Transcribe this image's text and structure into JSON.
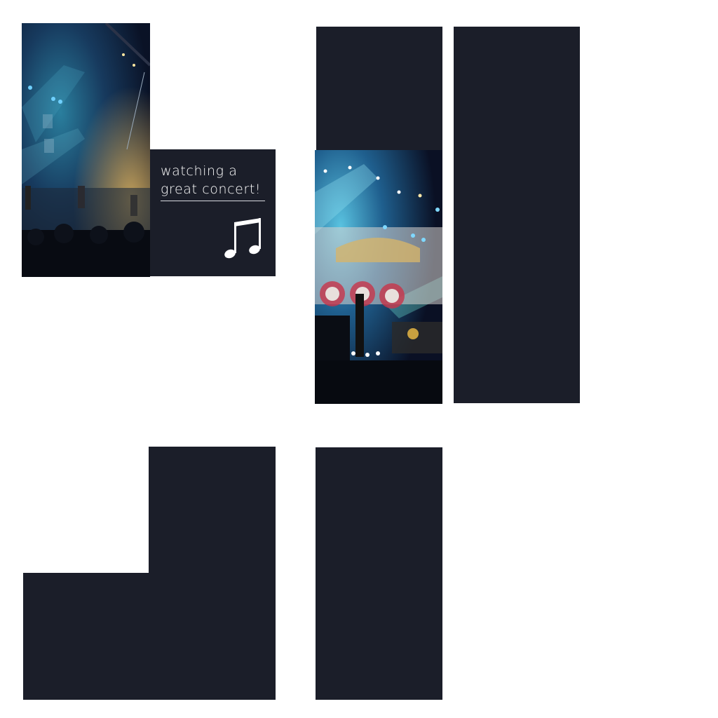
{
  "caption": {
    "text": "watching a great concert!"
  },
  "icons": {
    "caption_icon": "music-note-icon"
  },
  "photos": [
    {
      "name": "concert-photo-left",
      "description_visible": false
    },
    {
      "name": "concert-photo-center",
      "description_visible": false
    }
  ],
  "colors": {
    "background": "#ffffff",
    "block": "#1b1e29",
    "text": "#ffffff"
  }
}
